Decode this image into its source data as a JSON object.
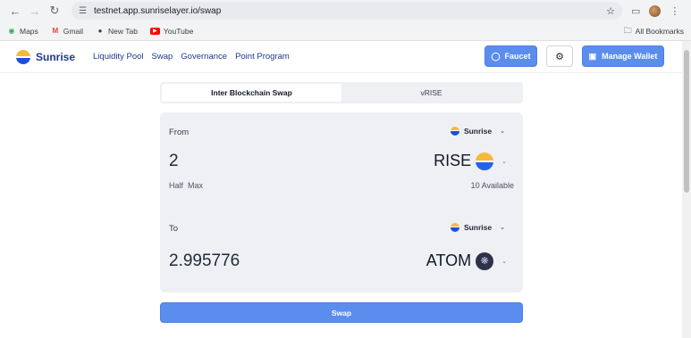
{
  "browser": {
    "url": "testnet.app.sunriselayer.io/swap",
    "bookmarks": [
      "Maps",
      "Gmail",
      "New Tab",
      "YouTube"
    ],
    "all_bookmarks": "All Bookmarks"
  },
  "header": {
    "brand": "Sunrise",
    "nav": [
      "Liquidity Pool",
      "Swap",
      "Governance",
      "Point Program"
    ],
    "faucet_label": "Faucet",
    "wallet_label": "Manage Wallet"
  },
  "tabs": [
    {
      "label": "Inter Blockchain Swap",
      "active": true
    },
    {
      "label": "vRISE",
      "active": false
    }
  ],
  "from": {
    "label": "From",
    "chain": "Sunrise",
    "amount": "2",
    "token": "RISE",
    "half": "Half",
    "max": "Max",
    "available": "10 Available"
  },
  "to": {
    "label": "To",
    "chain": "Sunrise",
    "amount": "2.995776",
    "token": "ATOM"
  },
  "swap_label": "Swap",
  "colors": {
    "primary": "#5b8def",
    "card_bg": "#eef0f4",
    "brand_text": "#1e3a8a"
  }
}
